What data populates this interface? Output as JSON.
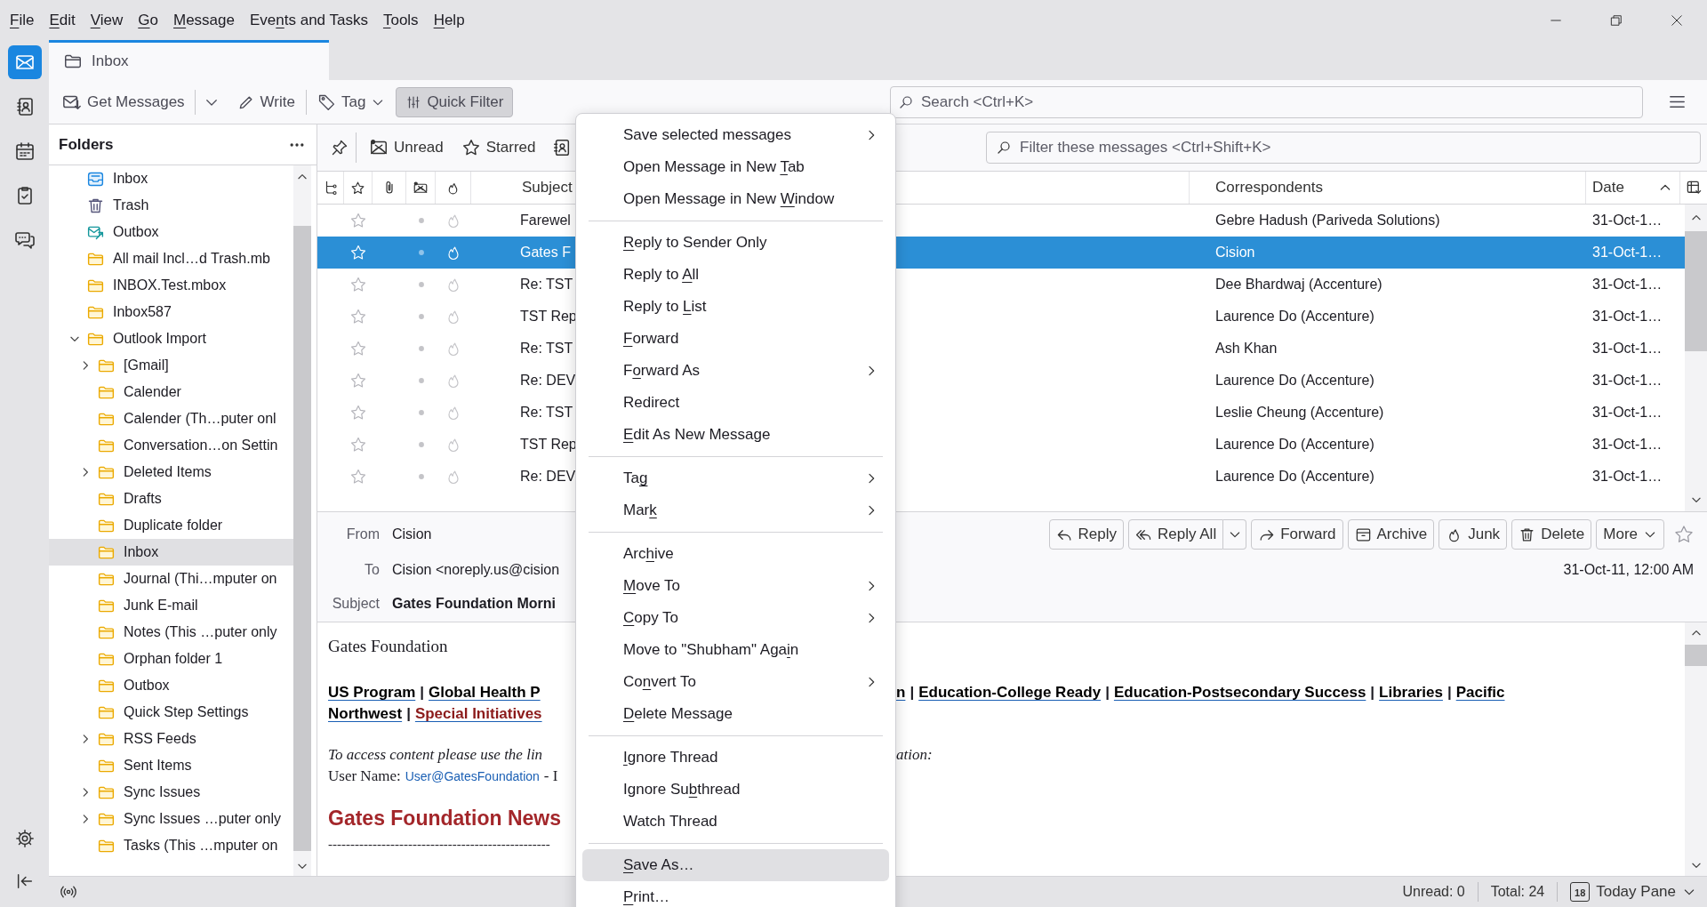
{
  "menu_bar": [
    {
      "key": "F",
      "post": "ile"
    },
    {
      "key": "E",
      "post": "dit"
    },
    {
      "key": "V",
      "post": "iew"
    },
    {
      "key": "G",
      "post": "o"
    },
    {
      "key": "M",
      "post": "essage"
    },
    {
      "pre": "Eve",
      "key": "n",
      "post": "ts and Tasks"
    },
    {
      "key": "T",
      "post": "ools"
    },
    {
      "key": "H",
      "post": "elp"
    }
  ],
  "spaces": [
    {
      "kind": "mail",
      "selected": true
    },
    {
      "kind": "addressbook",
      "selected": false
    },
    {
      "kind": "calendar",
      "selected": false
    },
    {
      "kind": "tasks",
      "selected": false
    },
    {
      "kind": "chat",
      "selected": false
    }
  ],
  "tab": {
    "title": "Inbox"
  },
  "toolbar": {
    "get_messages": "Get Messages",
    "write": "Write",
    "tag": "Tag",
    "quick_filter": {
      "label": "Quick Filter",
      "pressed": true
    },
    "search": {
      "placeholder": "Search <Ctrl+K>"
    }
  },
  "folder_pane": {
    "title": "Folders",
    "folders": [
      {
        "name": "Inbox",
        "kind": "inbox",
        "selected": false
      },
      {
        "name": "Trash",
        "kind": "trash",
        "selected": false
      },
      {
        "name": "Outbox",
        "kind": "outbox",
        "selected": false
      },
      {
        "name": "All mail Incl…d Trash.mb",
        "kind": "folder",
        "selected": false
      },
      {
        "name": "INBOX.Test.mbox",
        "kind": "folder",
        "selected": false
      },
      {
        "name": "Inbox587",
        "kind": "folder",
        "selected": false
      },
      {
        "name": "Outlook Import",
        "kind": "folder",
        "selected": false,
        "expanded": true,
        "children": [
          {
            "name": "[Gmail]",
            "kind": "folder",
            "selected": false,
            "expanded": false
          },
          {
            "name": "Calender",
            "kind": "folder",
            "selected": false
          },
          {
            "name": "Calender (Th…puter onl",
            "kind": "folder",
            "selected": false
          },
          {
            "name": "Conversation…on Settin",
            "kind": "folder",
            "selected": false
          },
          {
            "name": "Deleted Items",
            "kind": "folder",
            "selected": false,
            "expanded": false
          },
          {
            "name": "Drafts",
            "kind": "folder",
            "selected": false
          },
          {
            "name": "Duplicate folder",
            "kind": "folder",
            "selected": false
          },
          {
            "name": "Inbox",
            "kind": "folder",
            "selected": true
          },
          {
            "name": "Journal (Thi…mputer on",
            "kind": "folder",
            "selected": false
          },
          {
            "name": "Junk E-mail",
            "kind": "folder",
            "selected": false
          },
          {
            "name": "Notes (This …puter only",
            "kind": "folder",
            "selected": false
          },
          {
            "name": "Orphan folder 1",
            "kind": "folder",
            "selected": false
          },
          {
            "name": "Outbox",
            "kind": "folder",
            "selected": false
          },
          {
            "name": "Quick Step Settings",
            "kind": "folder",
            "selected": false
          },
          {
            "name": "RSS Feeds",
            "kind": "folder",
            "selected": false,
            "expanded": false
          },
          {
            "name": "Sent Items",
            "kind": "folder",
            "selected": false
          },
          {
            "name": "Sync Issues",
            "kind": "folder",
            "selected": false,
            "expanded": false
          },
          {
            "name": "Sync Issues …puter only",
            "kind": "folder",
            "selected": false,
            "expanded": false
          },
          {
            "name": "Tasks (This …mputer on",
            "kind": "folder",
            "selected": false
          }
        ]
      }
    ]
  },
  "quick_filter": {
    "buttons": [
      {
        "kind": "unread",
        "label": "Unread"
      },
      {
        "kind": "starred",
        "label": "Starred"
      },
      {
        "kind": "contact"
      }
    ],
    "filter": {
      "placeholder": "Filter these messages <Ctrl+Shift+K>"
    }
  },
  "columns": {
    "subject": "Subject",
    "correspondents": "Correspondents",
    "date": "Date"
  },
  "messages": [
    {
      "subject": "Farewel",
      "correspondent": "Gebre Hadush (Pariveda Solutions)",
      "date": "31-Oct-1…",
      "selected": false,
      "starred": false
    },
    {
      "subject": "Gates F",
      "correspondent": "Cision",
      "date": "31-Oct-1…",
      "selected": true,
      "starred": false
    },
    {
      "subject": "Re: TST",
      "correspondent": "Dee Bhardwaj (Accenture)",
      "date": "31-Oct-1…",
      "selected": false,
      "starred": false
    },
    {
      "subject": "TST Rep",
      "correspondent": "Laurence Do (Accenture)",
      "date": "31-Oct-1…",
      "selected": false,
      "starred": false
    },
    {
      "subject": "Re: TST",
      "correspondent": "Ash Khan",
      "date": "31-Oct-1…",
      "selected": false,
      "starred": false
    },
    {
      "subject": "Re: DEV",
      "correspondent": "Laurence Do (Accenture)",
      "date": "31-Oct-1…",
      "selected": false,
      "starred": false
    },
    {
      "subject": "Re: TST",
      "correspondent": "Leslie Cheung (Accenture)",
      "date": "31-Oct-1…",
      "selected": false,
      "starred": false
    },
    {
      "subject": "TST Rep",
      "correspondent": "Laurence Do (Accenture)",
      "date": "31-Oct-1…",
      "selected": false,
      "starred": false
    },
    {
      "subject": "Re: DEV",
      "correspondent": "Laurence Do (Accenture)",
      "date": "31-Oct-1…",
      "selected": false,
      "starred": false
    }
  ],
  "message_header": {
    "from_label": "From",
    "from": "Cision",
    "to_label": "To",
    "to": "Cision <noreply.us@cision",
    "subject_label": "Subject",
    "subject": "Gates Foundation Morni",
    "date": "31-Oct-11, 12:00 AM",
    "buttons": [
      {
        "kind": "reply",
        "label": "Reply"
      },
      {
        "kind": "reply_all",
        "label": "Reply All"
      },
      {
        "kind": "forward",
        "label": "Forward"
      },
      {
        "kind": "archive",
        "label": "Archive"
      },
      {
        "kind": "junk",
        "label": "Junk"
      },
      {
        "kind": "delete",
        "label": "Delete"
      },
      {
        "kind": "more",
        "label": "More"
      }
    ]
  },
  "body": {
    "heading": "Gates Foundation",
    "separator": "|",
    "link_lines": [
      {
        "left": [
          {
            "text": "US Program",
            "color": "#000000"
          },
          {
            "text": "Global Health P",
            "color": "#000000"
          }
        ],
        "right": [
          {
            "text": "n",
            "color": "#000000"
          },
          {
            "text": "Education-College Ready",
            "color": "#000000"
          },
          {
            "text": "Education-Postsecondary Success",
            "color": "#000000"
          },
          {
            "text": "Libraries",
            "color": "#000000"
          },
          {
            "text": "Pacific",
            "color": "#000000"
          }
        ]
      },
      {
        "left": [
          {
            "text": "Northwest",
            "color": "#000000"
          },
          {
            "text": "Special Initiatives",
            "color": "#8b1a1a"
          }
        ]
      }
    ],
    "note": {
      "left": "To access content please use the lin",
      "right": "ation:"
    },
    "user": {
      "label": "User Name:",
      "link": "User@GatesFoundation",
      "rest": "- I"
    },
    "news_title": "Gates Foundation News",
    "rule": "--------------------------------------------------"
  },
  "context_menu": [
    {
      "kind": "item",
      "label": {
        "pre": "Save selected messages"
      },
      "submenu": true,
      "selected": false
    },
    {
      "kind": "item",
      "label": {
        "pre": "Open Message in New ",
        "key": "T",
        "post": "ab"
      },
      "submenu": false,
      "selected": false
    },
    {
      "kind": "item",
      "label": {
        "pre": "Open Message in New ",
        "key": "W",
        "post": "indow"
      },
      "submenu": false,
      "selected": false
    },
    {
      "kind": "separator"
    },
    {
      "kind": "item",
      "label": {
        "key": "R",
        "post": "eply to Sender Only"
      },
      "submenu": false,
      "selected": false
    },
    {
      "kind": "item",
      "label": {
        "pre": "Reply to ",
        "key": "A",
        "post": "ll"
      },
      "submenu": false,
      "selected": false
    },
    {
      "kind": "item",
      "label": {
        "pre": "Reply to ",
        "key": "L",
        "post": "ist"
      },
      "submenu": false,
      "selected": false
    },
    {
      "kind": "item",
      "label": {
        "key": "F",
        "post": "orward"
      },
      "submenu": false,
      "selected": false
    },
    {
      "kind": "item",
      "label": {
        "pre": "F",
        "key": "o",
        "post": "rward As"
      },
      "submenu": true,
      "selected": false
    },
    {
      "kind": "item",
      "label": {
        "pre": "Redirect"
      },
      "submenu": false,
      "selected": false
    },
    {
      "kind": "item",
      "label": {
        "key": "E",
        "post": "dit As New Message"
      },
      "submenu": false,
      "selected": false
    },
    {
      "kind": "separator"
    },
    {
      "kind": "item",
      "label": {
        "pre": "Ta",
        "key": "g"
      },
      "submenu": true,
      "selected": false
    },
    {
      "kind": "item",
      "label": {
        "pre": "Mar",
        "key": "k"
      },
      "submenu": true,
      "selected": false
    },
    {
      "kind": "separator"
    },
    {
      "kind": "item",
      "label": {
        "pre": "Arc",
        "key": "h",
        "post": "ive"
      },
      "submenu": false,
      "selected": false
    },
    {
      "kind": "item",
      "label": {
        "key": "M",
        "post": "ove To"
      },
      "submenu": true,
      "selected": false
    },
    {
      "kind": "item",
      "label": {
        "key": "C",
        "post": "opy To"
      },
      "submenu": true,
      "selected": false
    },
    {
      "kind": "item",
      "label": {
        "pre": "Move to \"Shubham\" Aga",
        "key": "i",
        "post": "n"
      },
      "submenu": false,
      "selected": false
    },
    {
      "kind": "item",
      "label": {
        "pre": "Co",
        "key": "n",
        "post": "vert To"
      },
      "submenu": true,
      "selected": false
    },
    {
      "kind": "item",
      "label": {
        "key": "D",
        "post": "elete Message"
      },
      "submenu": false,
      "selected": false
    },
    {
      "kind": "separator"
    },
    {
      "kind": "item",
      "label": {
        "key": "I",
        "post": "gnore Thread"
      },
      "submenu": false,
      "selected": false
    },
    {
      "kind": "item",
      "label": {
        "pre": "Ignore Su",
        "key": "b",
        "post": "thread"
      },
      "submenu": false,
      "selected": false
    },
    {
      "kind": "item",
      "label": {
        "pre": "Watch Thread"
      },
      "submenu": false,
      "selected": false
    },
    {
      "kind": "separator"
    },
    {
      "kind": "item",
      "label": {
        "key": "S",
        "post": "ave As…"
      },
      "submenu": false,
      "selected": true
    },
    {
      "kind": "item",
      "label": {
        "key": "P",
        "post": "rint…"
      },
      "submenu": false,
      "selected": false
    }
  ],
  "status_bar": {
    "unread": "Unread: 0",
    "total": "Total: 24",
    "today_date": "18",
    "today_pane": "Today Pane"
  }
}
